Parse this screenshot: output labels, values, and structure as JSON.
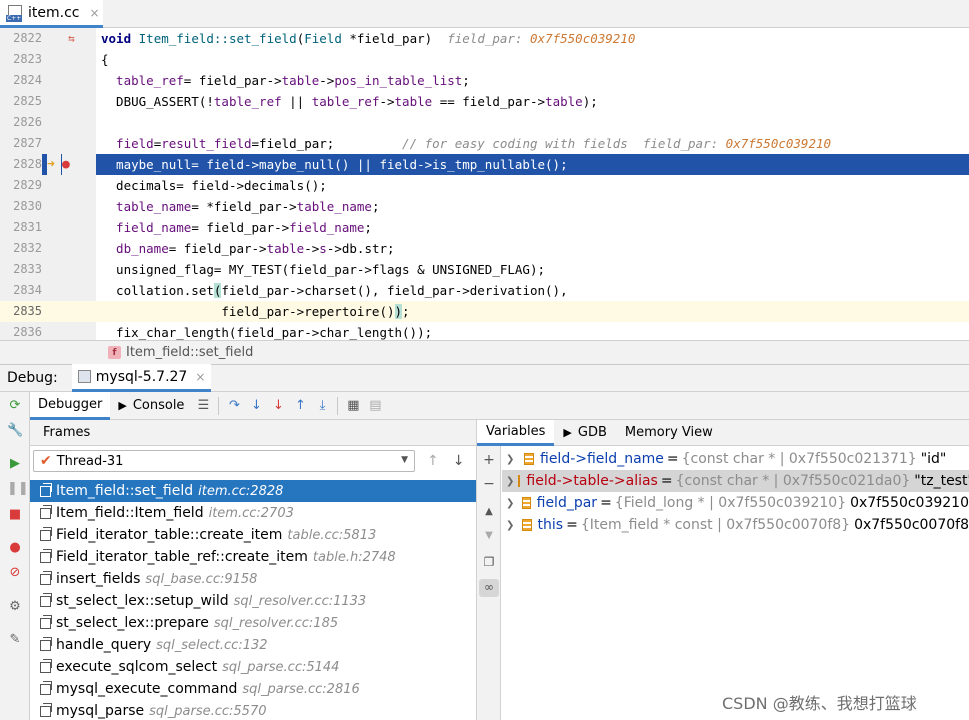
{
  "editor_tab": {
    "title": "item.cc",
    "close": "×"
  },
  "lines": [
    {
      "num": "2822",
      "parts": [
        {
          "t": "void ",
          "c": "kw"
        },
        {
          "t": "Item_field::",
          "c": "fn"
        },
        {
          "t": "set_field",
          "c": "fn"
        },
        {
          "t": "(",
          "c": ""
        },
        {
          "t": "Field ",
          "c": "fn"
        },
        {
          "t": "*field_par)  ",
          "c": ""
        },
        {
          "t": "field_par: ",
          "c": "inl"
        },
        {
          "t": "0x7f550c039210",
          "c": "inlv"
        }
      ]
    },
    {
      "num": "2823",
      "parts": [
        {
          "t": "{",
          "c": ""
        }
      ]
    },
    {
      "num": "2824",
      "parts": [
        {
          "t": "  table_ref",
          "c": "mb"
        },
        {
          "t": "= field_par->",
          "c": ""
        },
        {
          "t": "table",
          "c": "mb"
        },
        {
          "t": "->",
          "c": ""
        },
        {
          "t": "pos_in_table_list",
          "c": "mb"
        },
        {
          "t": ";",
          "c": ""
        }
      ]
    },
    {
      "num": "2825",
      "parts": [
        {
          "t": "  DBUG_ASSERT(!",
          "c": ""
        },
        {
          "t": "table_ref",
          "c": "mb"
        },
        {
          "t": " || ",
          "c": ""
        },
        {
          "t": "table_ref",
          "c": "mb"
        },
        {
          "t": "->",
          "c": ""
        },
        {
          "t": "table",
          "c": "mb"
        },
        {
          "t": " == field_par->",
          "c": ""
        },
        {
          "t": "table",
          "c": "mb"
        },
        {
          "t": ");",
          "c": ""
        }
      ]
    },
    {
      "num": "2826",
      "parts": []
    },
    {
      "num": "2827",
      "parts": [
        {
          "t": "  field",
          "c": "mb"
        },
        {
          "t": "=",
          "c": ""
        },
        {
          "t": "result_field",
          "c": "mb"
        },
        {
          "t": "=field_par;         ",
          "c": ""
        },
        {
          "t": "// for easy coding with fields  ",
          "c": "cm"
        },
        {
          "t": "field_par: ",
          "c": "inl"
        },
        {
          "t": "0x7f550c039210",
          "c": "inlv"
        }
      ]
    },
    {
      "num": "2828",
      "parts": [
        {
          "t": "  maybe_null= field->maybe_null() || field->is_tmp_nullable();",
          "c": ""
        }
      ]
    },
    {
      "num": "2829",
      "parts": [
        {
          "t": "  decimals",
          "c": ""
        },
        {
          "t": "= field->decimals();",
          "c": ""
        }
      ]
    },
    {
      "num": "2830",
      "parts": [
        {
          "t": "  table_name",
          "c": "mb"
        },
        {
          "t": "= *field_par->",
          "c": ""
        },
        {
          "t": "table_name",
          "c": "mb"
        },
        {
          "t": ";",
          "c": ""
        }
      ]
    },
    {
      "num": "2831",
      "parts": [
        {
          "t": "  field_name",
          "c": "mb"
        },
        {
          "t": "= field_par->",
          "c": ""
        },
        {
          "t": "field_name",
          "c": "mb"
        },
        {
          "t": ";",
          "c": ""
        }
      ]
    },
    {
      "num": "2832",
      "parts": [
        {
          "t": "  db_name",
          "c": "mb"
        },
        {
          "t": "= field_par->",
          "c": ""
        },
        {
          "t": "table",
          "c": "mb"
        },
        {
          "t": "->",
          "c": ""
        },
        {
          "t": "s",
          "c": "mb"
        },
        {
          "t": "->db.str;",
          "c": ""
        }
      ]
    },
    {
      "num": "2833",
      "parts": [
        {
          "t": "  unsigned_flag= MY_TEST(field_par->flags & UNSIGNED_FLAG);",
          "c": ""
        }
      ]
    },
    {
      "num": "2834",
      "parts": [
        {
          "t": "  collation.set",
          "c": ""
        },
        {
          "t": "(",
          "c": "bm"
        },
        {
          "t": "field_par->charset(), field_par->derivation(),",
          "c": ""
        }
      ]
    },
    {
      "num": "2835",
      "parts": [
        {
          "t": "                field_par->repertoire()",
          "c": ""
        },
        {
          "t": ")",
          "c": "bm"
        },
        {
          "t": ";",
          "c": ""
        }
      ]
    },
    {
      "num": "2836",
      "parts": [
        {
          "t": "  fix_char_length(field_par->char_length());",
          "c": ""
        }
      ]
    }
  ],
  "breadcrumb": {
    "badge": "f",
    "text": "Item_field::set_field"
  },
  "debug": {
    "label": "Debug:",
    "session": "mysql-5.7.27",
    "tabs": {
      "debugger": "Debugger",
      "console": "Console"
    }
  },
  "frames": {
    "header": "Frames",
    "thread": "Thread-31",
    "items": [
      {
        "name": "Item_field::set_field",
        "loc": "item.cc:2828"
      },
      {
        "name": "Item_field::Item_field",
        "loc": "item.cc:2703"
      },
      {
        "name": "Field_iterator_table::create_item",
        "loc": "table.cc:5813"
      },
      {
        "name": "Field_iterator_table_ref::create_item",
        "loc": "table.h:2748"
      },
      {
        "name": "insert_fields",
        "loc": "sql_base.cc:9158"
      },
      {
        "name": "st_select_lex::setup_wild",
        "loc": "sql_resolver.cc:1133"
      },
      {
        "name": "st_select_lex::prepare",
        "loc": "sql_resolver.cc:185"
      },
      {
        "name": "handle_query",
        "loc": "sql_select.cc:132"
      },
      {
        "name": "execute_sqlcom_select",
        "loc": "sql_parse.cc:5144"
      },
      {
        "name": "mysql_execute_command",
        "loc": "sql_parse.cc:2816"
      },
      {
        "name": "mysql_parse",
        "loc": "sql_parse.cc:5570"
      }
    ]
  },
  "variables": {
    "tabs": {
      "variables": "Variables",
      "gdb": "GDB",
      "memory": "Memory View"
    },
    "items": [
      {
        "name": "field->field_name",
        "type": "{const char * | 0x7f550c021371}",
        "value": "\"id\""
      },
      {
        "name": "field->table->alias",
        "type": "{const char * | 0x7f550c021da0}",
        "value": "\"tz_test\""
      },
      {
        "name": "field_par",
        "type": "{Field_long * | 0x7f550c039210}",
        "value": "0x7f550c039210"
      },
      {
        "name": "this",
        "type": "{Item_field * const | 0x7f550c0070f8}",
        "value": "0x7f550c0070f8"
      }
    ]
  },
  "watermark": "CSDN @教练、我想打篮球",
  "colors": {
    "selection": "#2154a9",
    "frame_selection": "#2675bf",
    "accent": "#4083c9"
  }
}
